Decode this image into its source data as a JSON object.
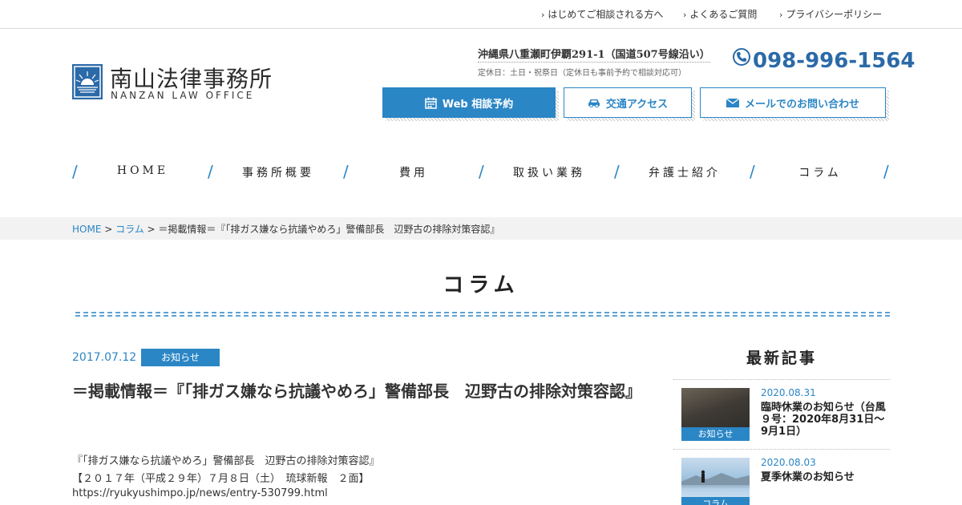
{
  "topnav": {
    "first_time": "はじめてご相談される方へ",
    "faq": "よくあるご質問",
    "privacy": "プライバシーポリシー"
  },
  "logo": {
    "jp": "南山法律事務所",
    "en": "NANZAN LAW OFFICE"
  },
  "contact": {
    "address": "沖縄県八重瀬町伊覇291-1（国道507号線沿い）",
    "hours": "定休日：土日・祝祭日（定休日も事前予約で相談対応可）",
    "phone": "098-996-1564"
  },
  "actions": {
    "web": "Web 相談予約",
    "access": "交通アクセス",
    "mail": "メールでのお問い合わせ"
  },
  "nav": {
    "home": "HOME",
    "office": "事務所概要",
    "fees": "費用",
    "services": "取扱い業務",
    "lawyers": "弁護士紹介",
    "column": "コラム"
  },
  "breadcrumb": {
    "home": "HOME",
    "sep": " > ",
    "column": "コラム",
    "current": "＝掲載情報＝『「排ガス嫌なら抗議やめろ」警備部長　辺野古の排除対策容認』"
  },
  "page_title": "コラム",
  "article": {
    "date": "2017.07.12",
    "category": "お知らせ",
    "title": "＝掲載情報＝『「排ガス嫌なら抗議やめろ」警備部長　辺野古の排除対策容認』",
    "body": [
      "『「排ガス嫌なら抗議やめろ」警備部長　辺野古の排除対策容認』",
      "【２０１７年（平成２９年）７月８日（土）　琉球新報　２面】",
      "https://ryukyushimpo.jp/news/entry-530799.html"
    ]
  },
  "sidebar": {
    "title": "最新記事",
    "posts": [
      {
        "date": "2020.08.31",
        "category": "お知らせ",
        "title": "臨時休業のお知らせ（台風９号：2020年8月31日～9月1日）"
      },
      {
        "date": "2020.08.03",
        "category": "コラム",
        "title": "夏季休業のお知らせ"
      }
    ]
  },
  "colors": {
    "accent": "#2b86c5",
    "logo_blue": "#2b6aa8"
  },
  "icons": [
    "chevron-right-icon",
    "phone-icon",
    "calendar-icon",
    "car-icon",
    "mail-icon",
    "sunrise-logo-icon"
  ]
}
